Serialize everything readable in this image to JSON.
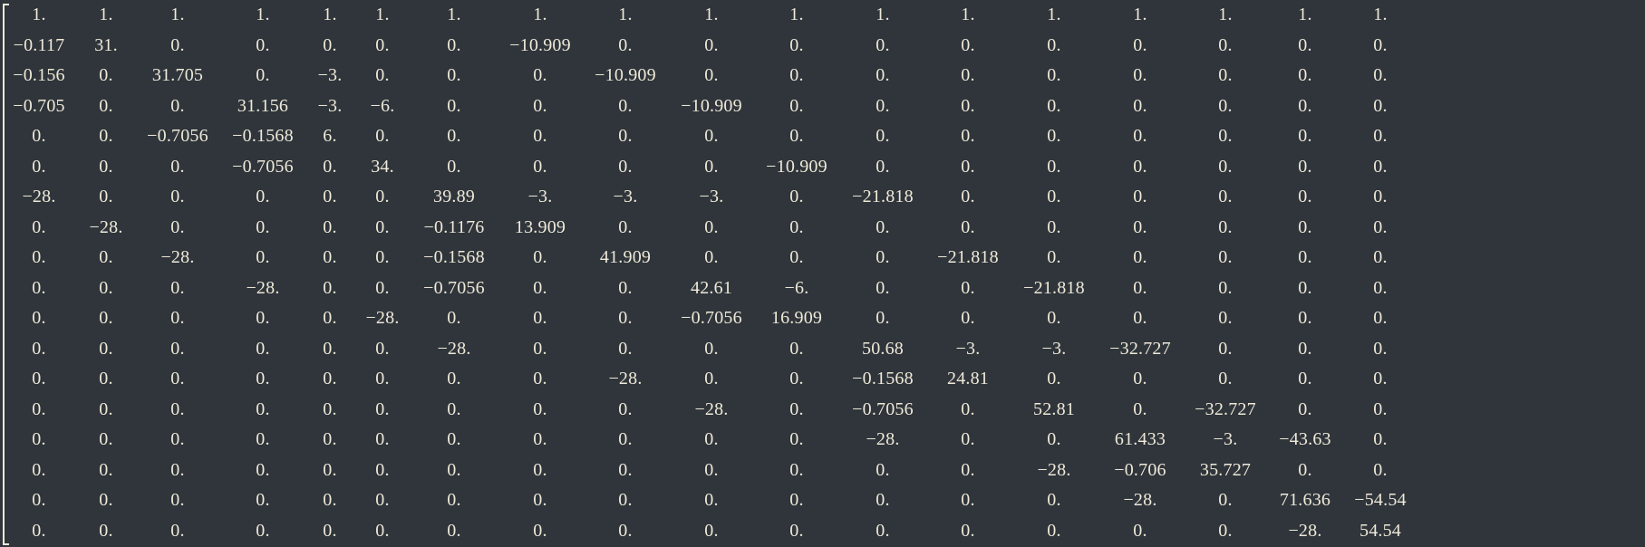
{
  "matrix": {
    "rows": [
      [
        "1.",
        "1.",
        "1.",
        "1.",
        "1.",
        "1.",
        "1.",
        "1.",
        "1.",
        "1.",
        "1.",
        "1.",
        "1.",
        "1.",
        "1.",
        "1.",
        "1.",
        "1."
      ],
      [
        "−0.117",
        "31.",
        "0.",
        "0.",
        "0.",
        "0.",
        "0.",
        "−10.909",
        "0.",
        "0.",
        "0.",
        "0.",
        "0.",
        "0.",
        "0.",
        "0.",
        "0.",
        "0."
      ],
      [
        "−0.156",
        "0.",
        "31.705",
        "0.",
        "−3.",
        "0.",
        "0.",
        "0.",
        "−10.909",
        "0.",
        "0.",
        "0.",
        "0.",
        "0.",
        "0.",
        "0.",
        "0.",
        "0."
      ],
      [
        "−0.705",
        "0.",
        "0.",
        "31.156",
        "−3.",
        "−6.",
        "0.",
        "0.",
        "0.",
        "−10.909",
        "0.",
        "0.",
        "0.",
        "0.",
        "0.",
        "0.",
        "0.",
        "0."
      ],
      [
        "0.",
        "0.",
        "−0.7056",
        "−0.1568",
        "6.",
        "0.",
        "0.",
        "0.",
        "0.",
        "0.",
        "0.",
        "0.",
        "0.",
        "0.",
        "0.",
        "0.",
        "0.",
        "0."
      ],
      [
        "0.",
        "0.",
        "0.",
        "−0.7056",
        "0.",
        "34.",
        "0.",
        "0.",
        "0.",
        "0.",
        "−10.909",
        "0.",
        "0.",
        "0.",
        "0.",
        "0.",
        "0.",
        "0."
      ],
      [
        "−28.",
        "0.",
        "0.",
        "0.",
        "0.",
        "0.",
        "39.89",
        "−3.",
        "−3.",
        "−3.",
        "0.",
        "−21.818",
        "0.",
        "0.",
        "0.",
        "0.",
        "0.",
        "0."
      ],
      [
        "0.",
        "−28.",
        "0.",
        "0.",
        "0.",
        "0.",
        "−0.1176",
        "13.909",
        "0.",
        "0.",
        "0.",
        "0.",
        "0.",
        "0.",
        "0.",
        "0.",
        "0.",
        "0."
      ],
      [
        "0.",
        "0.",
        "−28.",
        "0.",
        "0.",
        "0.",
        "−0.1568",
        "0.",
        "41.909",
        "0.",
        "0.",
        "0.",
        "−21.818",
        "0.",
        "0.",
        "0.",
        "0.",
        "0."
      ],
      [
        "0.",
        "0.",
        "0.",
        "−28.",
        "0.",
        "0.",
        "−0.7056",
        "0.",
        "0.",
        "42.61",
        "−6.",
        "0.",
        "0.",
        "−21.818",
        "0.",
        "0.",
        "0.",
        "0."
      ],
      [
        "0.",
        "0.",
        "0.",
        "0.",
        "0.",
        "−28.",
        "0.",
        "0.",
        "0.",
        "−0.7056",
        "16.909",
        "0.",
        "0.",
        "0.",
        "0.",
        "0.",
        "0.",
        "0."
      ],
      [
        "0.",
        "0.",
        "0.",
        "0.",
        "0.",
        "0.",
        "−28.",
        "0.",
        "0.",
        "0.",
        "0.",
        "50.68",
        "−3.",
        "−3.",
        "−32.727",
        "0.",
        "0.",
        "0."
      ],
      [
        "0.",
        "0.",
        "0.",
        "0.",
        "0.",
        "0.",
        "0.",
        "0.",
        "−28.",
        "0.",
        "0.",
        "−0.1568",
        "24.81",
        "0.",
        "0.",
        "0.",
        "0.",
        "0."
      ],
      [
        "0.",
        "0.",
        "0.",
        "0.",
        "0.",
        "0.",
        "0.",
        "0.",
        "0.",
        "−28.",
        "0.",
        "−0.7056",
        "0.",
        "52.81",
        "0.",
        "−32.727",
        "0.",
        "0."
      ],
      [
        "0.",
        "0.",
        "0.",
        "0.",
        "0.",
        "0.",
        "0.",
        "0.",
        "0.",
        "0.",
        "0.",
        "−28.",
        "0.",
        "0.",
        "61.433",
        "−3.",
        "−43.63",
        "0."
      ],
      [
        "0.",
        "0.",
        "0.",
        "0.",
        "0.",
        "0.",
        "0.",
        "0.",
        "0.",
        "0.",
        "0.",
        "0.",
        "0.",
        "−28.",
        "−0.706",
        "35.727",
        "0.",
        "0."
      ],
      [
        "0.",
        "0.",
        "0.",
        "0.",
        "0.",
        "0.",
        "0.",
        "0.",
        "0.",
        "0.",
        "0.",
        "0.",
        "0.",
        "0.",
        "−28.",
        "0.",
        "71.636",
        "−54.54"
      ],
      [
        "0.",
        "0.",
        "0.",
        "0.",
        "0.",
        "0.",
        "0.",
        "0.",
        "0.",
        "0.",
        "0.",
        "0.",
        "0.",
        "0.",
        "0.",
        "0.",
        "−28.",
        "54.54"
      ]
    ]
  },
  "colors": {
    "background": "#2f353b",
    "text": "#efe9d8"
  }
}
